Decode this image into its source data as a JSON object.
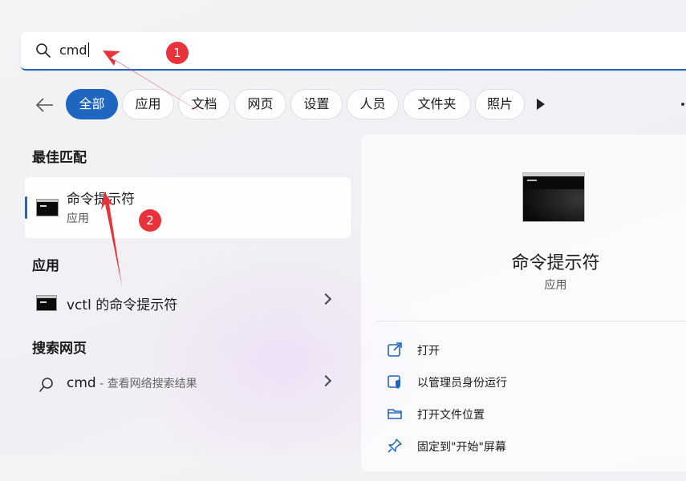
{
  "search": {
    "query": "cmd"
  },
  "filters": [
    {
      "label": "全部",
      "active": true
    },
    {
      "label": "应用"
    },
    {
      "label": "文档"
    },
    {
      "label": "网页"
    },
    {
      "label": "设置"
    },
    {
      "label": "人员"
    },
    {
      "label": "文件夹"
    },
    {
      "label": "照片"
    }
  ],
  "sections": {
    "best_match": "最佳匹配",
    "apps": "应用",
    "web": "搜索网页"
  },
  "best_match": {
    "title": "命令提示符",
    "subtitle": "应用",
    "icon": "cmd-icon"
  },
  "apps": [
    {
      "label": "vctl 的命令提示符",
      "icon": "cmd-icon"
    }
  ],
  "web": {
    "query": "cmd",
    "suffix": " - 查看网络搜索结果",
    "icon": "search-icon"
  },
  "detail": {
    "title": "命令提示符",
    "subtitle": "应用",
    "actions": [
      {
        "label": "打开",
        "icon": "open-external-icon"
      },
      {
        "label": "以管理员身份运行",
        "icon": "admin-shield-icon"
      },
      {
        "label": "打开文件位置",
        "icon": "folder-icon"
      },
      {
        "label": "固定到\"开始\"屏幕",
        "icon": "pin-icon"
      }
    ]
  },
  "annotations": [
    {
      "number": "1"
    },
    {
      "number": "2"
    }
  ],
  "colors": {
    "accent": "#1f66c1",
    "annotation": "#e8333a"
  }
}
